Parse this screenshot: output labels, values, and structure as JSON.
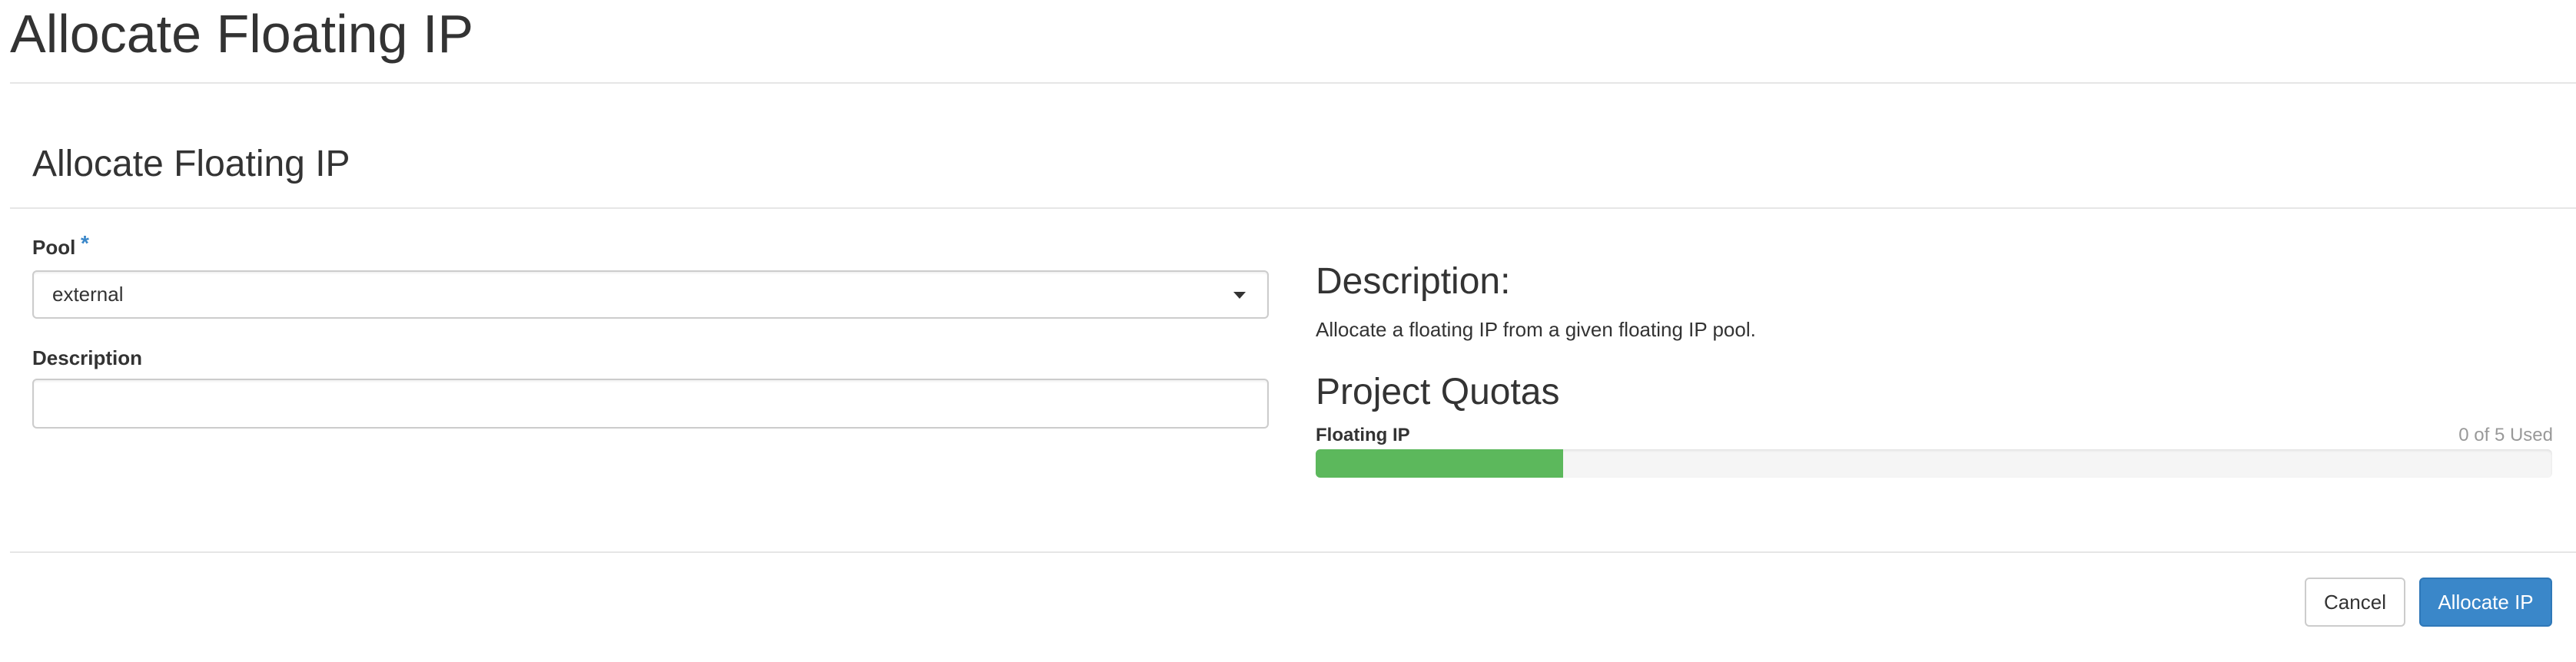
{
  "page": {
    "title": "Allocate Floating IP"
  },
  "modal": {
    "title": "Allocate Floating IP",
    "form": {
      "pool": {
        "label": "Pool",
        "required_marker": "*",
        "selected": "external"
      },
      "description": {
        "label": "Description",
        "value": "",
        "placeholder": ""
      }
    },
    "help": {
      "heading": "Description:",
      "text": "Allocate a floating IP from a given floating IP pool."
    },
    "quotas": {
      "heading": "Project Quotas",
      "items": [
        {
          "label": "Floating IP",
          "usage_text": "0 of 5 Used",
          "fill_fraction": 0.2,
          "bar_color": "#5cb85c"
        }
      ]
    },
    "footer": {
      "cancel_label": "Cancel",
      "submit_label": "Allocate IP"
    }
  },
  "colors": {
    "primary": "#3a87c9",
    "success": "#5cb85c",
    "border": "#cccccc"
  }
}
